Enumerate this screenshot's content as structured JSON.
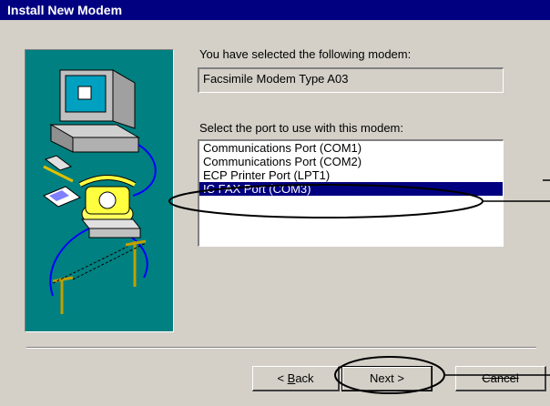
{
  "window": {
    "title": "Install New Modem"
  },
  "modem": {
    "label": "You have selected the following modem:",
    "value": "Facsimile Modem Type A03"
  },
  "ports": {
    "label": "Select the port to use with this modem:",
    "items": [
      "Communications Port (COM1)",
      "Communications Port (COM2)",
      "ECP Printer Port (LPT1)",
      "IC FAX Port (COM3)"
    ],
    "selected": "IC FAX Port (COM3)"
  },
  "buttons": {
    "back_prefix": "< ",
    "back_key": "B",
    "back_rest": "ack",
    "next": "Next >",
    "cancel": "Cancel"
  },
  "colors": {
    "titlebar": "#000080",
    "dialog": "#d4d0c8",
    "art_background": "#008080",
    "selection": "#000080"
  }
}
